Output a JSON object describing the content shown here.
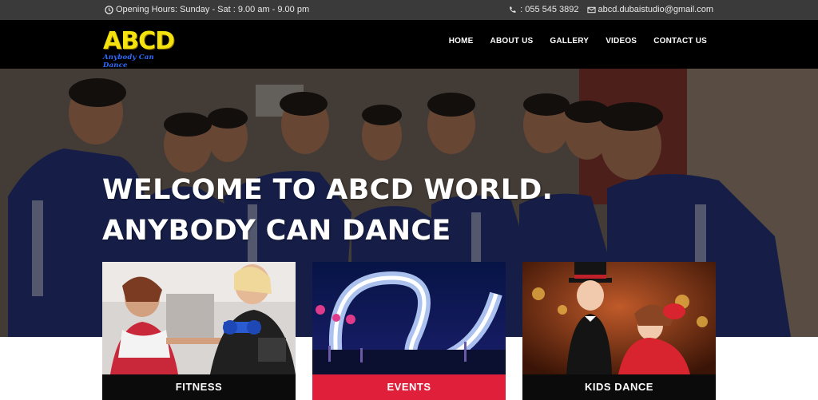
{
  "topbar": {
    "hours": "Opening Hours: Sunday - Sat : 9.00 am - 9.00 pm",
    "phone": ": 055 545 3892",
    "email": "abcd.dubaistudio@gmail.com"
  },
  "logo": {
    "main": "ABCD",
    "tagline": "Anybody Can Dance"
  },
  "nav": {
    "home": "HOME",
    "about": "ABOUT US",
    "gallery": "GALLERY",
    "videos": "VIDEOS",
    "contact": "CONTACT US"
  },
  "hero": {
    "line1": "WELCOME TO ABCD WORLD.",
    "line2": "ANYBODY CAN DANCE"
  },
  "cards": [
    {
      "label": "FITNESS",
      "color": "#0b0b0b"
    },
    {
      "label": "EVENTS",
      "color": "#e0203a"
    },
    {
      "label": "KIDS DANCE",
      "color": "#0b0b0b"
    }
  ],
  "colors": {
    "topbar": "#3a3a3a",
    "navbar": "#000000",
    "logo": "#f4e20e",
    "accent": "#e0203a"
  },
  "icons": [
    "clock-icon",
    "phone-icon",
    "envelope-icon"
  ]
}
